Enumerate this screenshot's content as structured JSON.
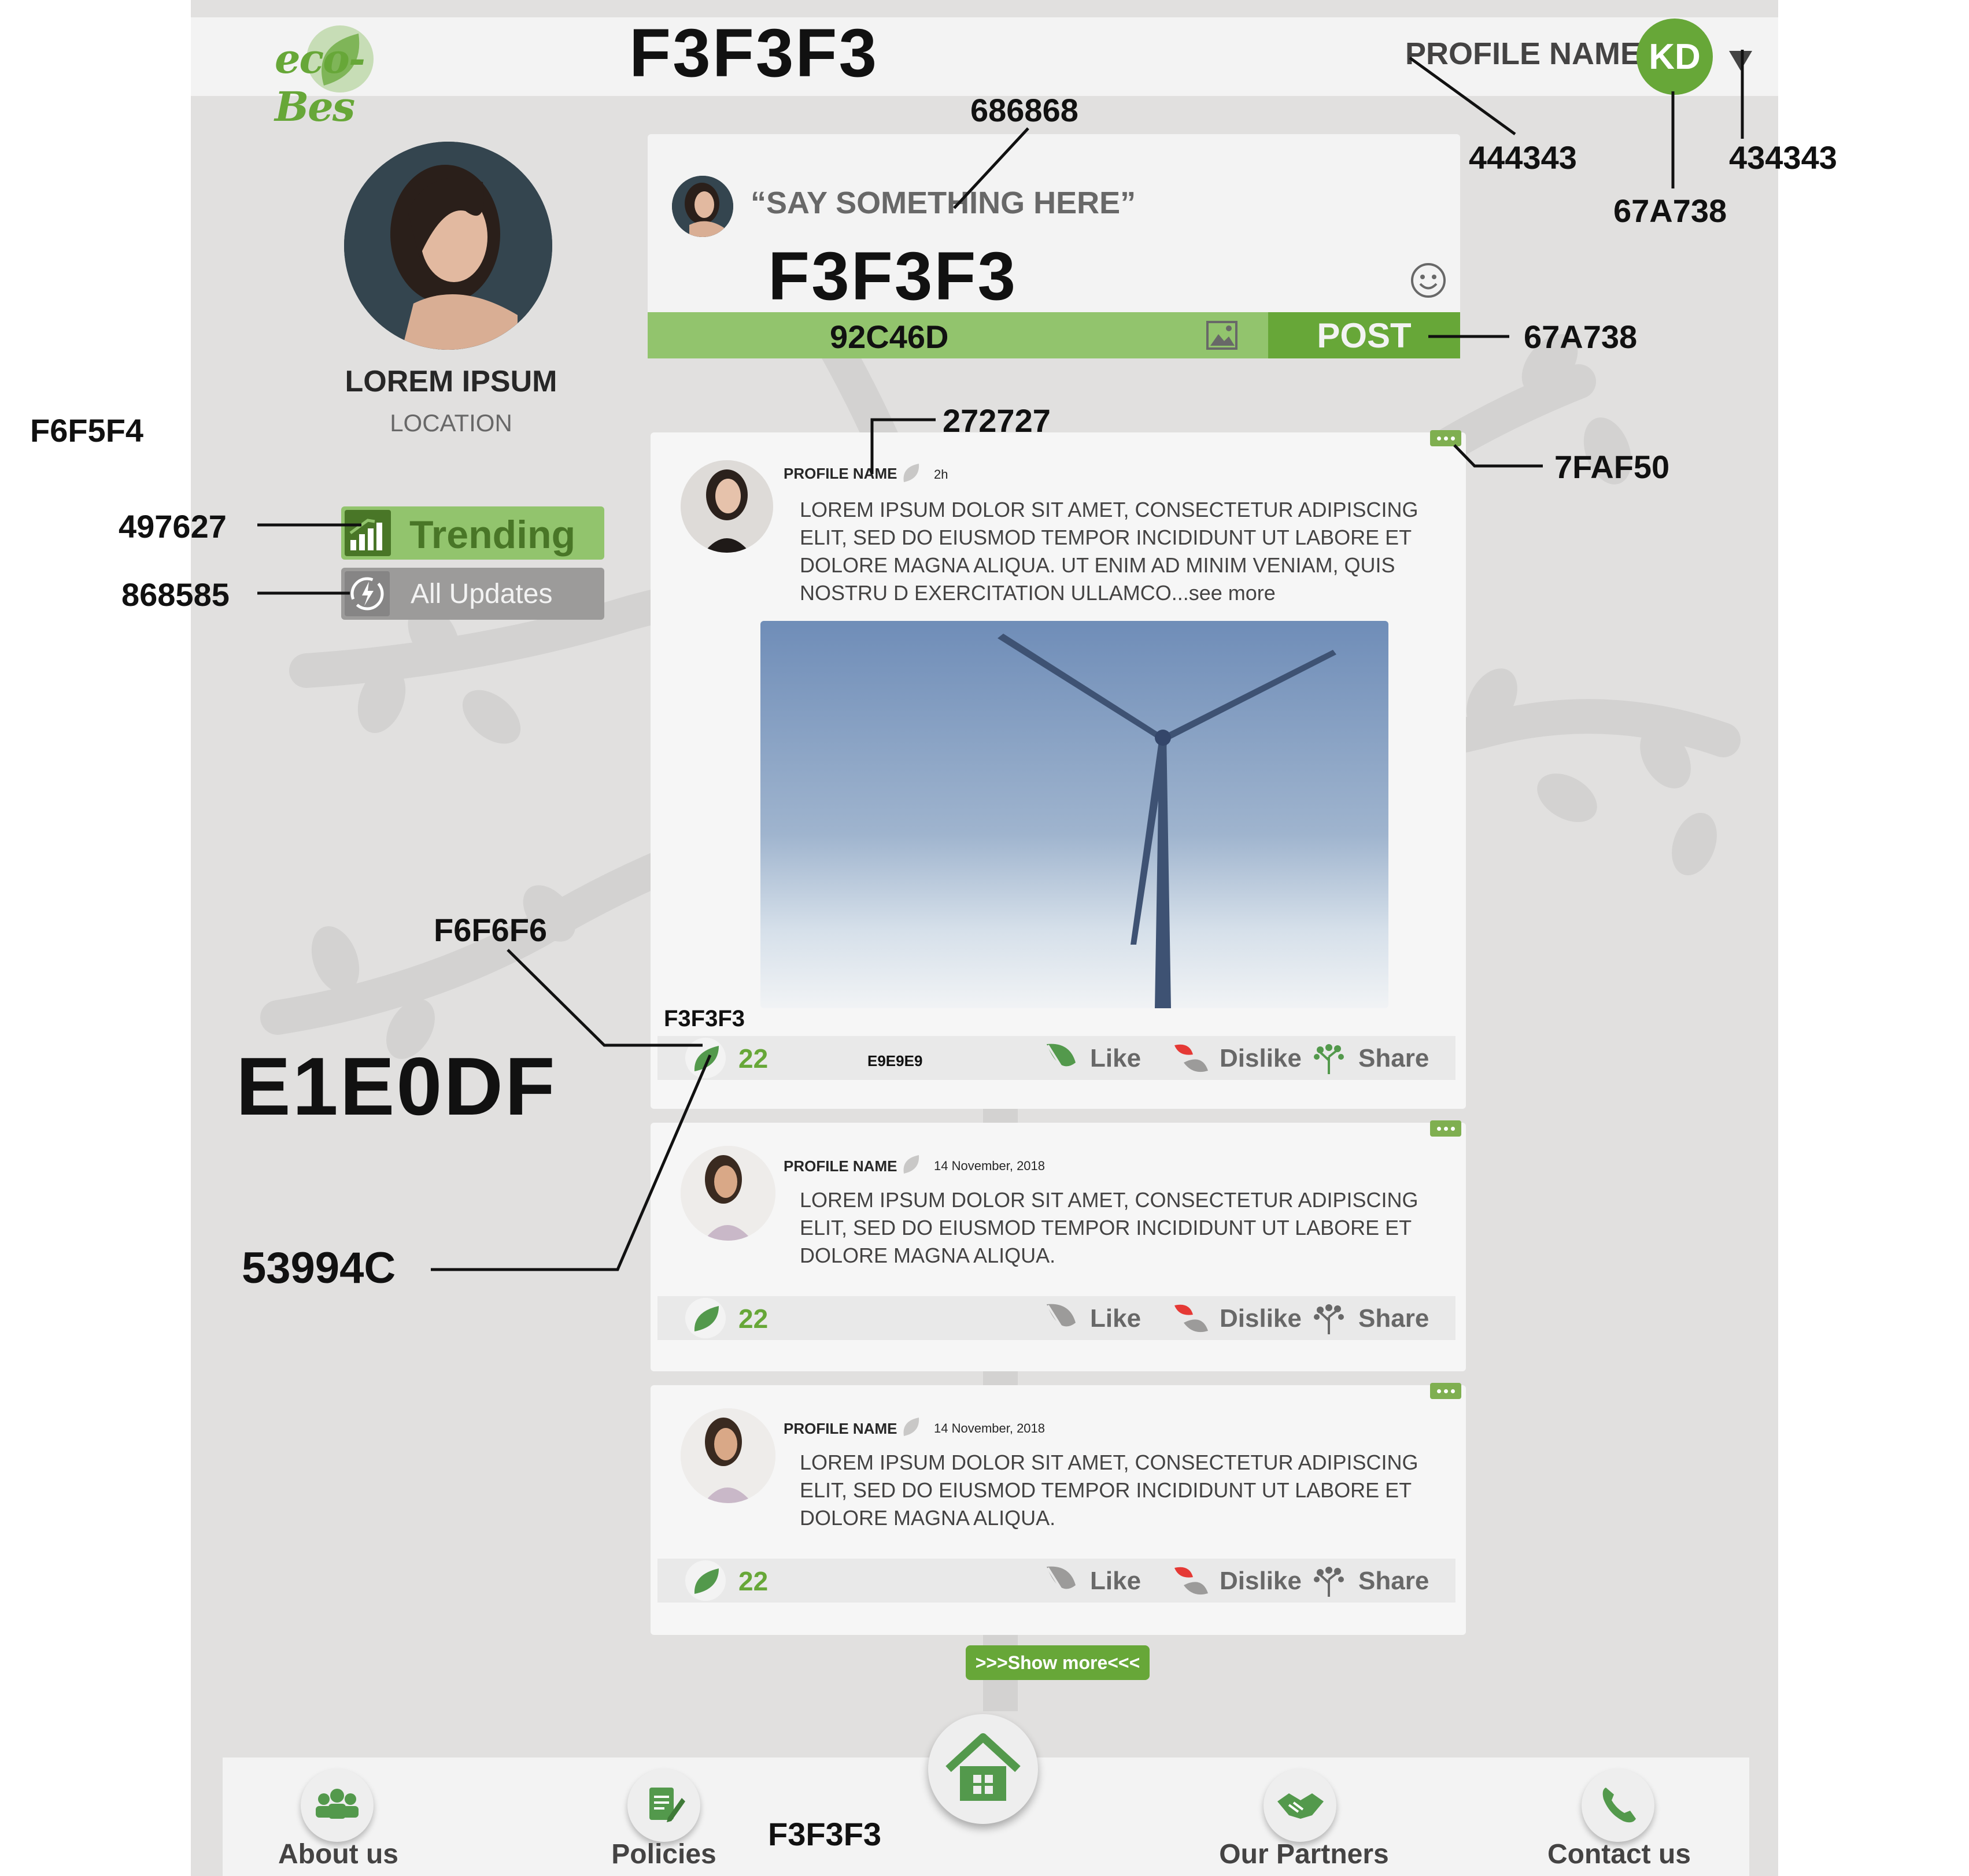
{
  "header": {
    "logo_text": "eco-Bes",
    "profile_name": "PROFILE NAME",
    "avatar_initials": "KD"
  },
  "profile": {
    "name": "LOREM IPSUM",
    "location": "LOCATION"
  },
  "sidebar": {
    "items": [
      {
        "label": "Trending",
        "icon": "trending-chart-icon"
      },
      {
        "label": "All Updates",
        "icon": "refresh-bolt-icon"
      }
    ]
  },
  "composer": {
    "placeholder": "“SAY SOMETHING HERE”",
    "post_label": "POST"
  },
  "posts": [
    {
      "author": "PROFILE NAME",
      "time": "2h",
      "text": "LOREM IPSUM DOLOR SIT AMET, CONSECTETUR ADIPISCING ELIT, SED DO EIUSMOD TEMPOR INCIDIDUNT UT LABORE ET DOLORE MAGNA ALIQUA. UT ENIM AD MINIM VENIAM, QUIS NOSTRU D EXERCITATION ULLAMCO",
      "see_more": "...see more",
      "count": "22",
      "like": "Like",
      "dislike": "Dislike",
      "share": "Share"
    },
    {
      "author": "PROFILE NAME",
      "time": "14 November, 2018",
      "text": "LOREM IPSUM DOLOR SIT AMET, CONSECTETUR ADIPISCING ELIT, SED DO EIUSMOD TEMPOR INCIDIDUNT UT LABORE ET DOLORE MAGNA ALIQUA.",
      "count": "22",
      "like": "Like",
      "dislike": "Dislike",
      "share": "Share"
    },
    {
      "author": "PROFILE NAME",
      "time": "14 November, 2018",
      "text": "LOREM IPSUM DOLOR SIT AMET, CONSECTETUR ADIPISCING ELIT, SED DO EIUSMOD TEMPOR INCIDIDUNT UT LABORE ET DOLORE MAGNA ALIQUA.",
      "count": "22",
      "like": "Like",
      "dislike": "Dislike",
      "share": "Share"
    }
  ],
  "show_more": ">>>Show more<<<",
  "footer": {
    "items": [
      {
        "label": "About us",
        "icon": "people-icon"
      },
      {
        "label": "Policies",
        "icon": "document-edit-icon"
      },
      {
        "label": "Our Partners",
        "icon": "handshake-icon"
      },
      {
        "label": "Contact us",
        "icon": "phone-icon"
      }
    ],
    "home_icon": "home-icon"
  },
  "annotations": {
    "header_bg": "F3F3F3",
    "say_color": "686868",
    "profile_name_color": "444343",
    "caret_color": "434343",
    "avatar_color": "67A738",
    "composer_bg": "F3F3F3",
    "composer_bar": "92C46D",
    "post_btn": "67A738",
    "text_color": "272727",
    "more_btn": "7FAF50",
    "left_bg": "F6F5F4",
    "trending_color": "497627",
    "updates_color": "868585",
    "card_bg": "F6F6F6",
    "action_bg_label": "F3F3F3",
    "bar_bg": "E9E9E9",
    "page_bg": "E1E0DF",
    "leaf_color": "53994C",
    "footer_bg": "F3F3F3"
  },
  "colors": {
    "page_bg": "#E1E0DF",
    "header_bg": "#F3F3F3",
    "accent": "#67A738",
    "light_green": "#92C46D",
    "dark_green": "#497627",
    "more_green": "#7FAF50",
    "card_bg": "#F6F6F6",
    "bar_bg": "#E9E9E9",
    "leaf": "#53994C"
  }
}
